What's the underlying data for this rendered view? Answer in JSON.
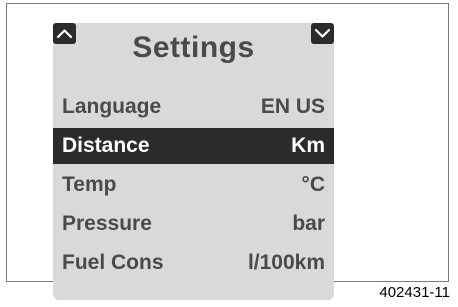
{
  "screen": {
    "title": "Settings",
    "rows": [
      {
        "label": "Language",
        "value": "EN US",
        "selected": false
      },
      {
        "label": "Distance",
        "value": "Km",
        "selected": true
      },
      {
        "label": "Temp",
        "value": "°C",
        "selected": false
      },
      {
        "label": "Pressure",
        "value": "bar",
        "selected": false
      },
      {
        "label": "Fuel Cons",
        "value": "l/100km",
        "selected": false
      }
    ],
    "icons": {
      "up": "chevron-up-icon",
      "down": "chevron-down-icon"
    }
  },
  "caption": "402431-11",
  "colors": {
    "screen_bg": "#d9d9d9",
    "selected_bg": "#2b2b2b",
    "text": "#4a4a4a"
  }
}
